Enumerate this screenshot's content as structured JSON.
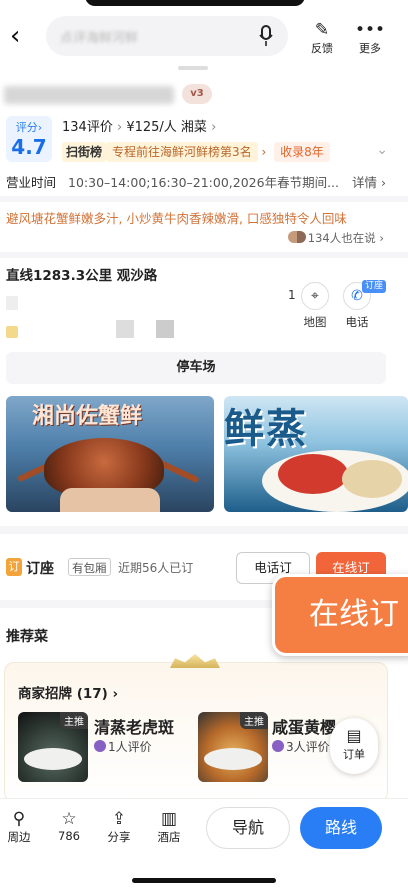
{
  "topbar": {
    "search_placeholder": "点评海鲜河鲜",
    "feedback_label": "反馈",
    "more_label": "更多"
  },
  "header": {
    "vip_badge": "v3"
  },
  "rating": {
    "score_label": "评分",
    "score_arrow": "›",
    "score_value": "4.7",
    "reviews": "134评价",
    "price": "¥125/人",
    "cuisine": "湘菜",
    "rank_tag": "扫街榜",
    "rank_text": "专程前往海鲜河鲜榜第3名",
    "years_tag": "收录8年"
  },
  "hours": {
    "label": "营业时间",
    "value": "10:30–14:00;16:30–21:00,2026年春节期间...",
    "detail": "详情 ›"
  },
  "highlight": {
    "quote": "避风塘花蟹鲜嫩多汁, 小炒黄牛肉香辣嫩滑, 口感独特令人回味",
    "people_saying": "134人也在说 ›"
  },
  "location": {
    "distance": "直线1283.3公里 观沙路",
    "count": "1",
    "map_label": "地图",
    "phone_label": "电话",
    "call_badge": "订座"
  },
  "parking": {
    "label": "停车场"
  },
  "banners": {
    "left_title": "湘尚佐蟹鲜",
    "right_title": "鲜蒸"
  },
  "booking": {
    "icon_text": "订",
    "title": "订座",
    "tag": "有包厢",
    "recent": "近期56人已订",
    "call_btn": "电话订",
    "online_btn": "在线订",
    "float_online": "在线订"
  },
  "recommend": {
    "title": "推荐菜",
    "signature": "商家招牌 (17) ›",
    "dishes": [
      {
        "tag": "主推",
        "name": "清蒸老虎斑",
        "eval": "1人评价"
      },
      {
        "tag": "主推",
        "name": "咸蛋黄樱",
        "eval": "3人评价"
      }
    ],
    "order_label": "订单"
  },
  "bottombar": {
    "nearby": "周边",
    "favorites": "786",
    "share": "分享",
    "hotel": "酒店",
    "navigate": "导航",
    "route": "路线"
  }
}
